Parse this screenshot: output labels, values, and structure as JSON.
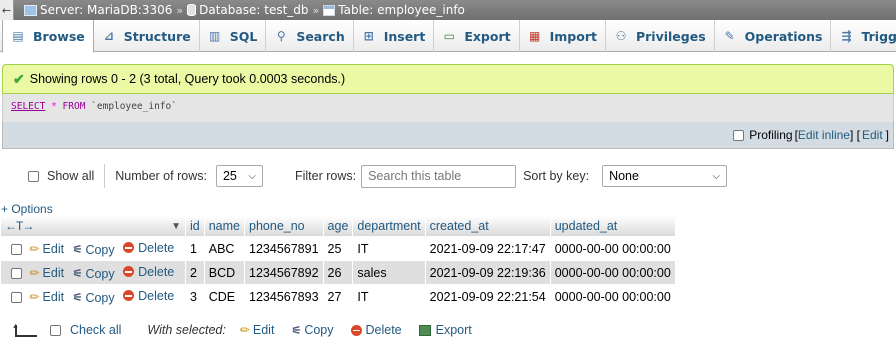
{
  "breadcrumb": {
    "back_glyph": "←",
    "server": "Server: MariaDB:3306",
    "database": "Database: test_db",
    "table": "Table: employee_info",
    "separator": "»"
  },
  "tabs": [
    {
      "label": "Browse",
      "icon": "browse-icon"
    },
    {
      "label": "Structure",
      "icon": "structure-icon"
    },
    {
      "label": "SQL",
      "icon": "sql-icon"
    },
    {
      "label": "Search",
      "icon": "search-icon"
    },
    {
      "label": "Insert",
      "icon": "insert-icon"
    },
    {
      "label": "Export",
      "icon": "export-icon"
    },
    {
      "label": "Import",
      "icon": "import-icon"
    },
    {
      "label": "Privileges",
      "icon": "privileges-icon"
    },
    {
      "label": "Operations",
      "icon": "operations-icon"
    },
    {
      "label": "Triggers",
      "icon": "triggers-icon"
    }
  ],
  "message": {
    "text": "Showing rows 0 - 2 (3 total, Query took 0.0003 seconds.)"
  },
  "sql": {
    "select": "SELECT",
    "star": "*",
    "from": "FROM",
    "table": "`employee_info`"
  },
  "profiling": {
    "label": "Profiling",
    "bracket_open": "[",
    "edit_inline": "Edit inline",
    "mid": "] [",
    "edit": "Edit",
    "bracket_close": "]"
  },
  "nav": {
    "show_all": "Show all",
    "rows_label": "Number of rows:",
    "rows_value": "25",
    "filter_label": "Filter rows:",
    "filter_placeholder": "Search this table",
    "sort_label": "Sort by key:",
    "sort_value": "None"
  },
  "options_link": "+ Options",
  "table": {
    "arrows": "←T→",
    "columns": [
      "id",
      "name",
      "phone_no",
      "age",
      "department",
      "created_at",
      "updated_at"
    ],
    "actions": {
      "edit": "Edit",
      "copy": "Copy",
      "delete": "Delete"
    },
    "rows": [
      {
        "id": "1",
        "name": "ABC",
        "phone_no": "1234567891",
        "age": "25",
        "department": "IT",
        "created_at": "2021-09-09 22:17:47",
        "updated_at": "0000-00-00 00:00:00"
      },
      {
        "id": "2",
        "name": "BCD",
        "phone_no": "1234567892",
        "age": "26",
        "department": "sales",
        "created_at": "2021-09-09 22:19:36",
        "updated_at": "0000-00-00 00:00:00"
      },
      {
        "id": "3",
        "name": "CDE",
        "phone_no": "1234567893",
        "age": "27",
        "department": "IT",
        "created_at": "2021-09-09 22:21:54",
        "updated_at": "0000-00-00 00:00:00"
      }
    ]
  },
  "bottom": {
    "check_all": "Check all",
    "with_selected": "With selected:",
    "edit": "Edit",
    "copy": "Copy",
    "delete": "Delete",
    "export": "Export"
  }
}
